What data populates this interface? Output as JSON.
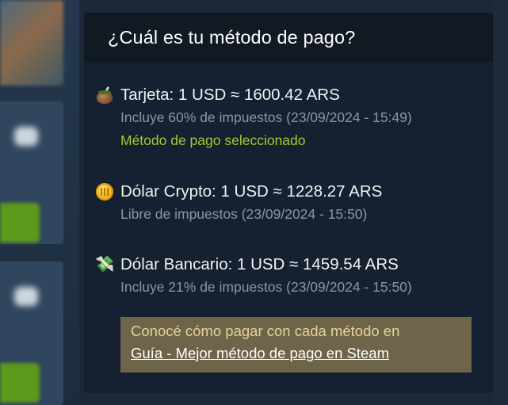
{
  "dialog": {
    "title": "¿Cuál es tu método de pago?"
  },
  "methods": [
    {
      "icon": "mate-icon",
      "title": "Tarjeta: 1 USD ≈ 1600.42 ARS",
      "subtitle": "Incluye 60% de impuestos (23/09/2024 - 15:49)",
      "status": "Método de pago seleccionado"
    },
    {
      "icon": "coin-icon",
      "title": "Dólar Crypto: 1 USD ≈ 1228.27 ARS",
      "subtitle": "Libre de impuestos (23/09/2024 - 15:50)"
    },
    {
      "icon": "money-with-wings-icon",
      "title": "Dólar Bancario: 1 USD ≈ 1459.54 ARS",
      "subtitle": "Incluye 21% de impuestos (23/09/2024 - 15:50)"
    }
  ],
  "info": {
    "text": "Conocé cómo pagar con cada método en",
    "link": "Guía - Mejor método de pago en Steam"
  },
  "colors": {
    "panel_bg": "#152130",
    "header_bg": "#111922",
    "selected_green": "#9acd32",
    "info_bg": "#6e6449",
    "info_text": "#e6d39a"
  }
}
